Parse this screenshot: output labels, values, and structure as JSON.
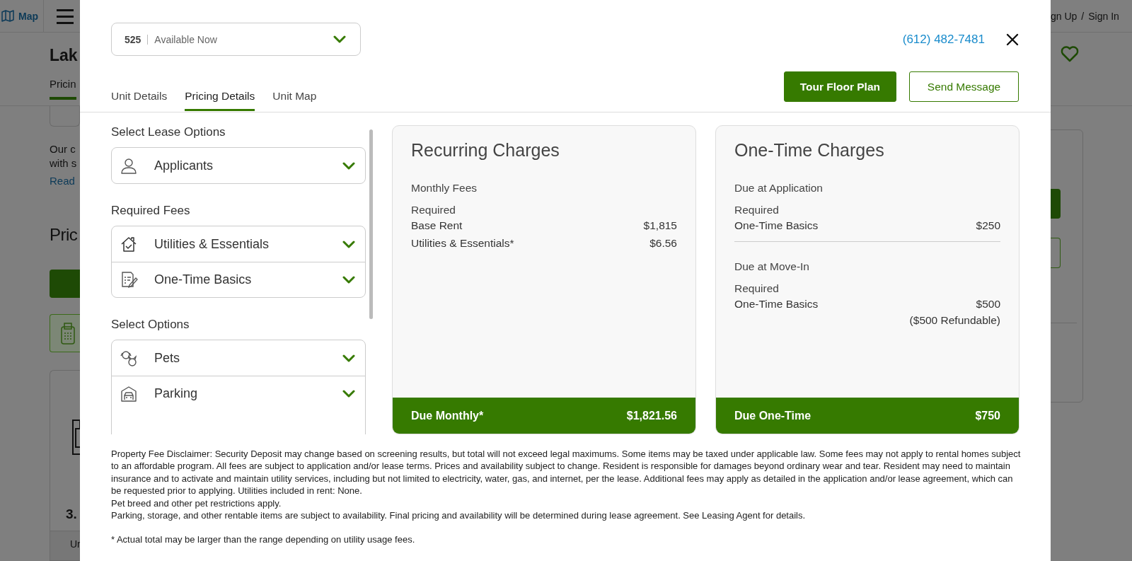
{
  "background_page": {
    "map_link": "Map",
    "auth_links": [
      "gn Up",
      "/",
      "Sign In"
    ],
    "title": "Lak",
    "tab": {
      "label": "Pricin",
      "selected": true
    },
    "text_lines": [
      "Our c",
      "with s"
    ],
    "link": "Read",
    "section_heading": "Pric",
    "card_value": "3.",
    "table_header": "Ur"
  },
  "modal": {
    "unit_select": {
      "unit": "525",
      "status": "Available Now"
    },
    "phone": "(612) 482-7481",
    "tabs": [
      {
        "label": "Unit Details",
        "selected": false
      },
      {
        "label": "Pricing Details",
        "selected": true
      },
      {
        "label": "Unit Map",
        "selected": false
      }
    ],
    "actions": [
      {
        "label": "Tour Floor Plan",
        "kind": "primary"
      },
      {
        "label": "Send Message",
        "kind": "secondary"
      }
    ],
    "option_groups": [
      {
        "heading": "Select Lease Options",
        "items": [
          "Applicants"
        ]
      },
      {
        "heading": "Required Fees",
        "items": [
          "Utilities & Essentials",
          "One-Time Basics"
        ]
      },
      {
        "heading": "Select Options",
        "items": [
          "Pets",
          "Parking"
        ]
      }
    ],
    "charges": [
      {
        "title": "Recurring Charges",
        "sections": [
          {
            "heading": "Monthly Fees",
            "subheading": "Required",
            "lines": [
              {
                "label": "Base Rent",
                "amount": "$1,815"
              },
              {
                "label": "Utilities & Essentials*",
                "amount": "$6.56"
              }
            ]
          }
        ],
        "total_label": "Due Monthly*",
        "total": "$1,821.56"
      },
      {
        "title": "One-Time Charges",
        "sections": [
          {
            "heading": "Due at Application",
            "subheading": "Required",
            "lines": [
              {
                "label": "One-Time Basics",
                "amount": "$250"
              }
            ]
          },
          {
            "heading": "Due at Move-In",
            "subheading": "Required",
            "lines": [
              {
                "label": "One-Time Basics",
                "amount": "$500",
                "note": "($500 Refundable)"
              }
            ]
          }
        ],
        "total_label": "Due One-Time",
        "total": "$750"
      }
    ],
    "disclaimer": [
      "Property Fee Disclaimer: Security Deposit may change based on screening results, but total will not exceed legal maximums. Some items may be taxed under applicable law. Some fees may not apply to rental homes subject to an affordable program. All fees are subject to application and/or lease terms. Prices and availability subject to change. Resident is responsible for damages beyond ordinary wear and tear. Resident may need to maintain insurance and to activate and maintain utility services, including but not limited to electricity, water, gas, and internet, per the lease. Additional fees may apply as detailed in the application and/or lease agreement, which can be requested prior to applying. Utilities included in rent: None.",
      "Pet breed and other pet restrictions apply.",
      "Parking, storage, and other rentable items are subject to availability. Final pricing and availability will be determined during lease agreement. See Leasing Agent for details."
    ],
    "footnote": "* Actual total may be larger than the range depending on utility usage fees."
  }
}
